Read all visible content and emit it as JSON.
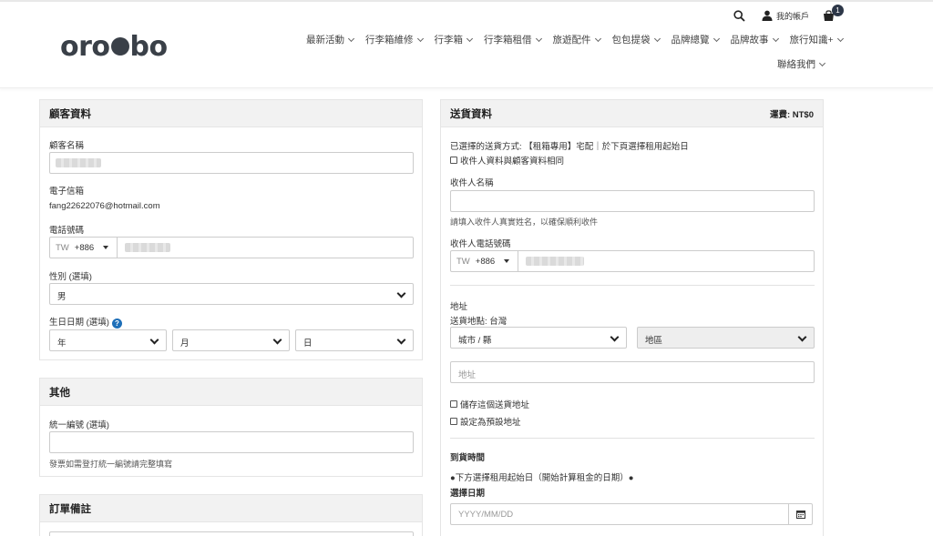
{
  "header": {
    "logo": "oro bo",
    "account_label": "我的帳戶",
    "cart_count": "1",
    "nav_row1": [
      "最新活動",
      "行李箱維修",
      "行李箱",
      "行李箱租借",
      "旅遊配件",
      "包包提袋",
      "品牌總覽",
      "品牌故事",
      "旅行知識+"
    ],
    "nav_row2": [
      "聯絡我們"
    ]
  },
  "customer": {
    "title": "顧客資料",
    "name_label": "顧客名稱",
    "email_label": "電子信箱",
    "email_value": "fang22622076@hotmail.com",
    "phone_label": "電話號碼",
    "phone_cc": "TW",
    "phone_code": "+886",
    "gender_label": "性別 (選填)",
    "gender_value": "男",
    "birthday_label": "生日日期 (選填)",
    "year": "年",
    "month": "月",
    "day": "日"
  },
  "other": {
    "title": "其他",
    "tax_label": "統一編號 (選填)",
    "tax_hint": "發票如需登打統一編號請完整填寫"
  },
  "notes": {
    "title": "訂單備註"
  },
  "delivery": {
    "title": "送貨資料",
    "shipping_label": "運費: NT$0",
    "method_text": "已選擇的送貨方式: 【租箱專用】宅配｜於下頁選擇租用起始日",
    "same_as_customer": "收件人資料與顧客資料相同",
    "recipient_name_label": "收件人名稱",
    "recipient_hint": "請填入收件人真實姓名，以確保順利收件",
    "recipient_phone_label": "收件人電話號碼",
    "phone_cc": "TW",
    "phone_code": "+886",
    "address_label": "地址",
    "region_text": "送貨地點: 台灣",
    "city_select": "城市 / 縣",
    "district_select": "地區",
    "address_placeholder": "地址",
    "save_address": "儲存這個送貨地址",
    "set_default": "設定為預設地址",
    "arrival_label": "到貨時間",
    "arrival_note": "●下方選擇租用起始日（開始計算租金的日期）●",
    "choose_date_label": "選擇日期",
    "date_placeholder": "YYYY/MM/DD"
  }
}
